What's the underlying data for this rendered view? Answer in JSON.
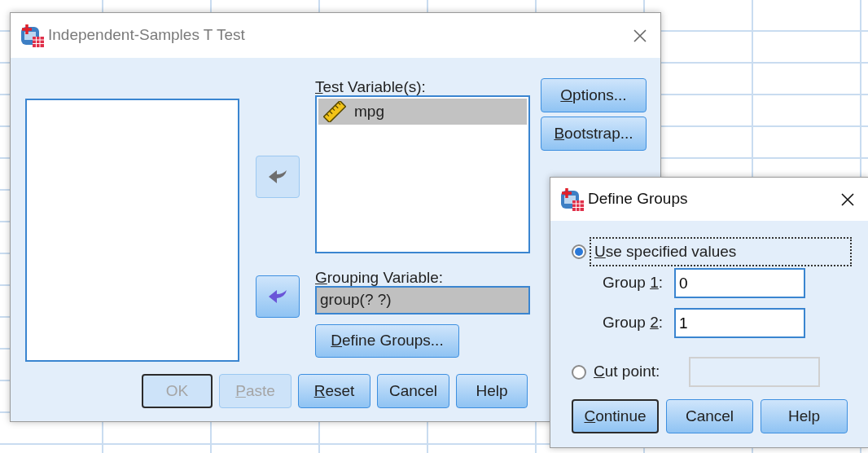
{
  "main_dialog": {
    "title": "Independent-Samples T Test",
    "active": false,
    "move_buttons": [
      {
        "disabled": true
      },
      {
        "disabled": false
      }
    ],
    "test_variables": {
      "label": {
        "key": "T",
        "after": "est Variable(s):"
      },
      "items": [
        {
          "name": "mpg",
          "selected": true
        }
      ]
    },
    "grouping_variable": {
      "label": {
        "key": "G",
        "after": "rouping Variable:"
      },
      "value": "group(? ?)"
    },
    "define_groups_button": {
      "label": {
        "key": "D",
        "after": "efine Groups..."
      }
    },
    "side_buttons": [
      {
        "label": {
          "key": "O",
          "after": "ptions..."
        }
      },
      {
        "label": {
          "key": "B",
          "after": "ootstrap..."
        }
      }
    ],
    "buttons": [
      {
        "label": {
          "before": "OK"
        },
        "disabled": true,
        "default": true
      },
      {
        "label": {
          "key": "P",
          "after": "aste"
        },
        "disabled": true,
        "default": false
      },
      {
        "label": {
          "key": "R",
          "after": "eset"
        },
        "disabled": false,
        "default": false
      },
      {
        "label": {
          "before": "Cancel"
        },
        "disabled": false,
        "default": false
      },
      {
        "label": {
          "before": "Help"
        },
        "disabled": false,
        "default": false
      }
    ]
  },
  "define_groups_dialog": {
    "title": "Define Groups",
    "active": true,
    "options": [
      {
        "label": {
          "key": "U",
          "after": "se specified values"
        },
        "selected": true,
        "focused": true
      },
      {
        "label": {
          "key": "C",
          "after": "ut point:"
        },
        "selected": false,
        "focused": false
      }
    ],
    "groups": [
      {
        "label": {
          "before": "Group ",
          "key": "1",
          "after": ":"
        },
        "value": "0"
      },
      {
        "label": {
          "before": "Group ",
          "key": "2",
          "after": ":"
        },
        "value": "1"
      }
    ],
    "cut_point": {
      "disabled": true
    },
    "buttons": [
      {
        "label": {
          "key": "C",
          "after": "ontinue"
        },
        "default": true
      },
      {
        "label": {
          "before": "Cancel"
        },
        "default": false
      },
      {
        "label": {
          "before": "Help"
        },
        "default": false
      }
    ]
  }
}
